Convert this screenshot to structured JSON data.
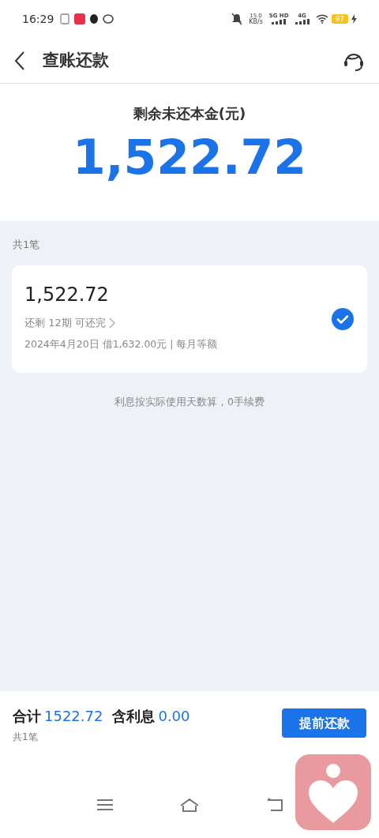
{
  "status_bar": {
    "time": "16:29",
    "speed": "15.0",
    "speed_unit": "KB/s",
    "network_1": "5G HD",
    "network_2": "4G",
    "battery": "97"
  },
  "header": {
    "title": "查账还款"
  },
  "summary": {
    "label": "剩余未还本金(元)",
    "amount": "1,522.72"
  },
  "list": {
    "count": "共1笔",
    "loans": [
      {
        "amount": "1,522.72",
        "remaining": "还剩 12期 可还完",
        "detail": "2024年4月20日 借1,632.00元 | 每月等额",
        "selected": true
      }
    ],
    "note": "利息按实际使用天数算，0手续费"
  },
  "footer": {
    "total_label": "合计",
    "total": "1522.72",
    "interest_label": "含利息",
    "interest": "0.00",
    "count": "共1笔",
    "button": "提前还款"
  }
}
